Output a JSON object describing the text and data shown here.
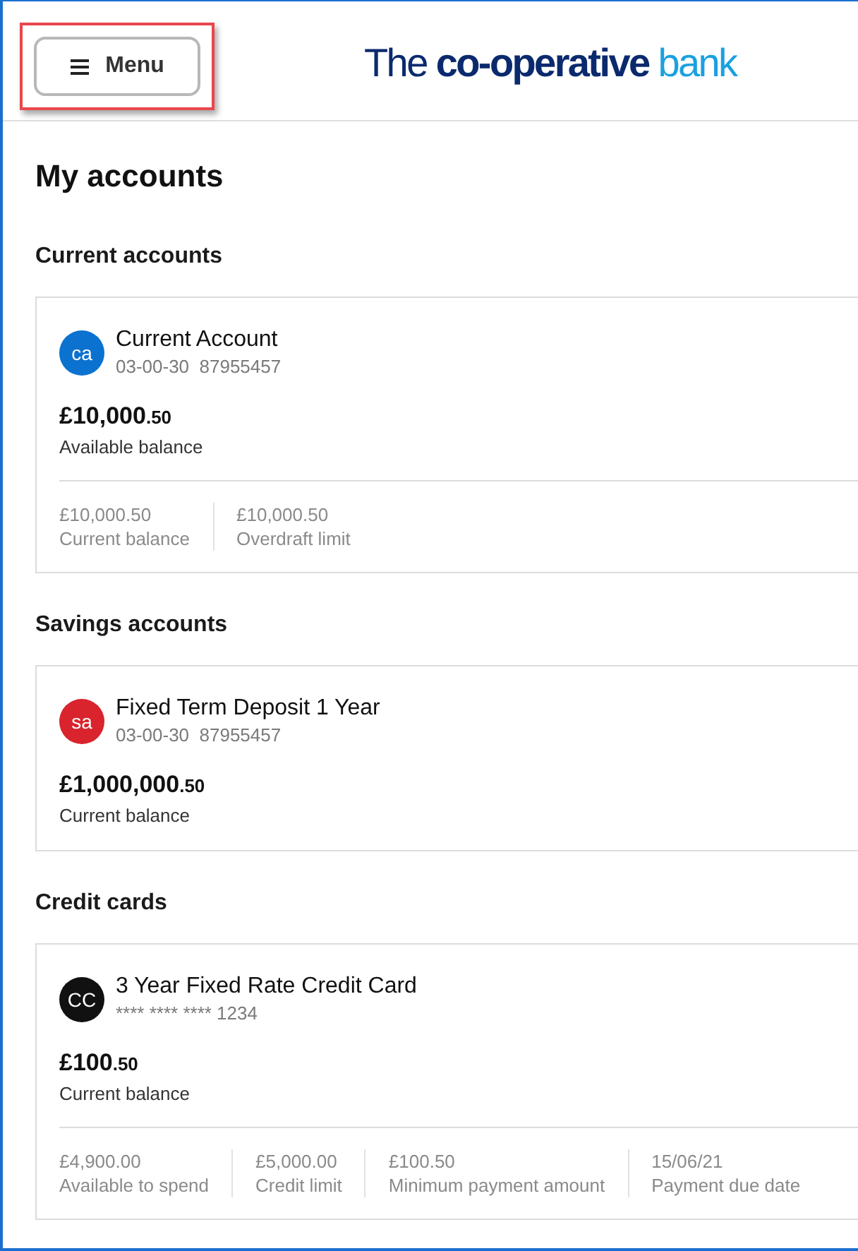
{
  "header": {
    "menu_button": {
      "label": "Menu",
      "highlighted": true
    },
    "logo": [
      {
        "text": "The",
        "kind": "light"
      },
      {
        "text": "co-operative",
        "kind": "bold"
      },
      {
        "text": "bank",
        "kind": "accent"
      }
    ]
  },
  "page_title": "My accounts",
  "sections": [
    {
      "heading": "Current accounts",
      "accounts": [
        {
          "badge": "ca",
          "color": "#0b72d0",
          "name": "Current Account",
          "number": "03-00-30  87955457",
          "balance_main": "£10,000",
          "balance_pence": ".50",
          "balance_label": "Available balance",
          "details": [
            {
              "value": "£10,000.50",
              "label": "Current balance"
            },
            {
              "value": "£10,000.50",
              "label": "Overdraft limit"
            }
          ]
        }
      ]
    },
    {
      "heading": "Savings accounts",
      "accounts": [
        {
          "badge": "sa",
          "color": "#d9232d",
          "name": "Fixed Term Deposit 1 Year",
          "number": "03-00-30  87955457",
          "balance_main": "£1,000,000",
          "balance_pence": ".50",
          "balance_label": "Current balance"
        }
      ]
    },
    {
      "heading": "Credit cards",
      "accounts": [
        {
          "badge": "CC",
          "color": "#111111",
          "name": "3 Year Fixed Rate Credit Card",
          "number": "**** **** **** 1234",
          "balance_main": "£100",
          "balance_pence": ".50",
          "balance_label": "Current balance",
          "details": [
            {
              "value": "£4,900.00",
              "label": "Available to spend"
            },
            {
              "value": "£5,000.00",
              "label": "Credit limit"
            },
            {
              "value": "£100.50",
              "label": "Minimum payment amount"
            },
            {
              "value": "15/06/21",
              "label": "Payment due date"
            }
          ]
        }
      ]
    }
  ]
}
